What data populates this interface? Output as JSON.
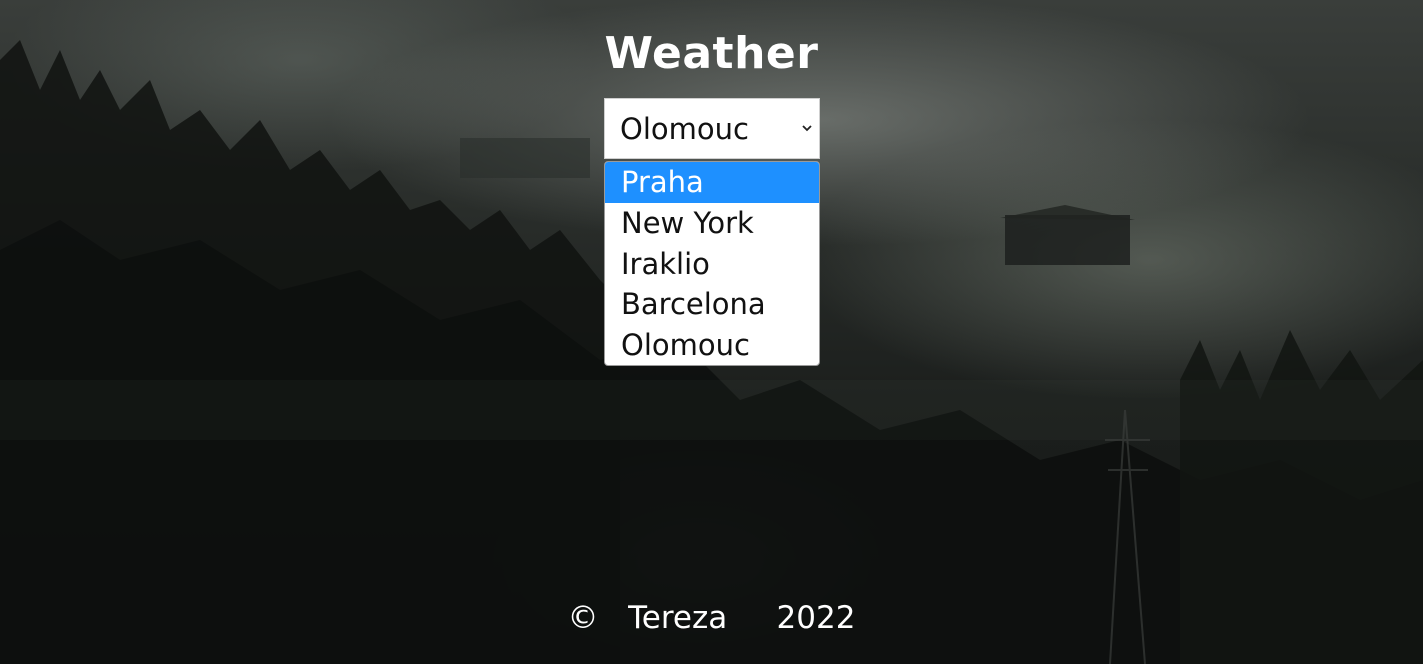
{
  "header": {
    "title": "Weather"
  },
  "city_select": {
    "selected": "Olomouc",
    "options": [
      {
        "label": "Praha",
        "highlighted": true
      },
      {
        "label": "New York",
        "highlighted": false
      },
      {
        "label": "Iraklio",
        "highlighted": false
      },
      {
        "label": "Barcelona",
        "highlighted": false
      },
      {
        "label": "Olomouc",
        "highlighted": false
      }
    ],
    "expanded": true
  },
  "footer": {
    "copyright_symbol": "©",
    "author": "Tereza",
    "year": "2022"
  },
  "colors": {
    "highlight": "#1e90ff",
    "text_light": "#ffffff",
    "background_dark": "#1c1f1d"
  },
  "icons": {
    "select_arrow": "chevron-down-icon"
  }
}
